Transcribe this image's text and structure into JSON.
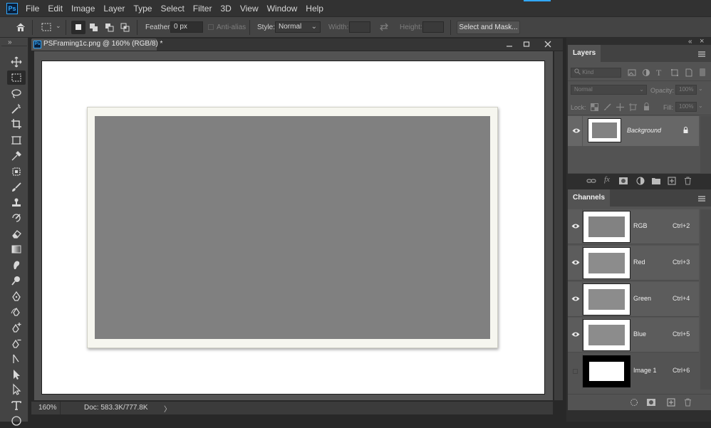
{
  "app": {
    "logo_text": "Ps",
    "accent": "#31a8ff"
  },
  "menu": [
    "File",
    "Edit",
    "Image",
    "Layer",
    "Type",
    "Select",
    "Filter",
    "3D",
    "View",
    "Window",
    "Help"
  ],
  "options": {
    "feather_label": "Feather:",
    "feather_value": "0 px",
    "antialias_label": "Anti-alias",
    "style_label": "Style:",
    "style_value": "Normal",
    "width_label": "Width:",
    "height_label": "Height:",
    "select_mask": "Select and Mask..."
  },
  "toolbar": {
    "collapse_glyph": "»",
    "tools": [
      "move-tool",
      "rectangular-marquee-tool",
      "lasso-tool",
      "magic-wand-tool",
      "crop-tool",
      "frame-tool",
      "eyedropper-tool",
      "spot-healing-tool",
      "brush-tool",
      "clone-stamp-tool",
      "history-brush-tool",
      "eraser-tool",
      "gradient-tool",
      "smudge-tool",
      "dodge-tool",
      "pen-tool",
      "freeform-pen-tool",
      "add-anchor-tool",
      "delete-anchor-tool",
      "convert-point-tool",
      "path-selection-tool",
      "direct-selection-tool",
      "type-tool",
      "ellipse-tool"
    ],
    "active_tool": "rectangular-marquee-tool"
  },
  "document": {
    "tab_icon": "Ps",
    "title": "PSFraming1c.png @ 160% (RGB/8) *",
    "window_controls": [
      "minimize",
      "restore",
      "close"
    ],
    "colors": {
      "canvas": "#ffffff",
      "frame": "#f6f6ef",
      "photo": "#808080"
    }
  },
  "status": {
    "zoom": "160%",
    "doc_size": "Doc: 583.3K/777.8K",
    "arrow": "〉"
  },
  "dock": {
    "collapse_glyph": "«",
    "close_glyph": "×"
  },
  "layers_panel": {
    "tab": "Layers",
    "filter_placeholder": "Kind",
    "blend_mode": "Normal",
    "opacity_label": "Opacity:",
    "opacity_value": "100%",
    "lock_label": "Lock:",
    "fill_label": "Fill:",
    "fill_value": "100%",
    "layers": [
      {
        "name": "Background",
        "visible": true,
        "locked": true
      }
    ]
  },
  "channels_panel": {
    "tab": "Channels",
    "channels": [
      {
        "name": "RGB",
        "shortcut": "Ctrl+2",
        "visible": true
      },
      {
        "name": "Red",
        "shortcut": "Ctrl+3",
        "visible": true
      },
      {
        "name": "Green",
        "shortcut": "Ctrl+4",
        "visible": true
      },
      {
        "name": "Blue",
        "shortcut": "Ctrl+5",
        "visible": true
      },
      {
        "name": "Image 1",
        "shortcut": "Ctrl+6",
        "visible": false
      }
    ]
  }
}
